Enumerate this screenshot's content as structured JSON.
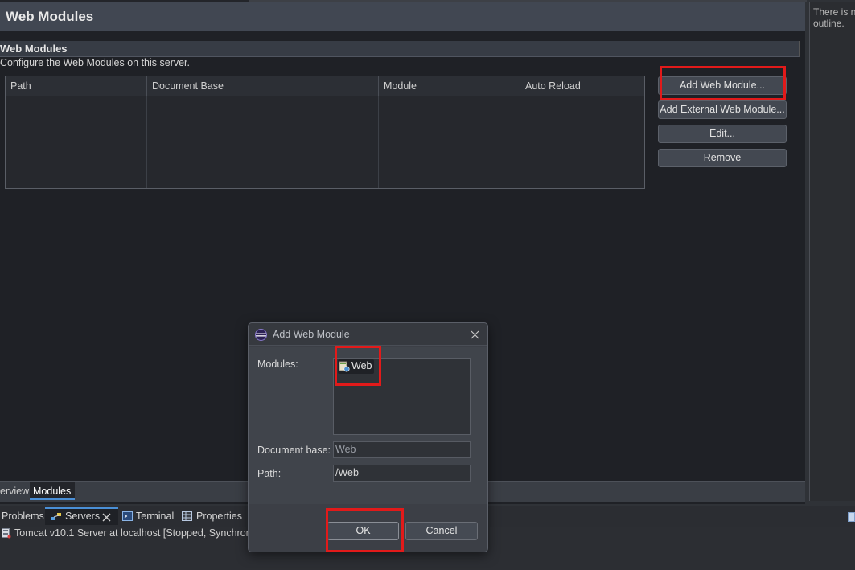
{
  "editor": {
    "header_title": "Web Modules",
    "section_title": "Web Modules",
    "section_description": "Configure the Web Modules on this server.",
    "table_columns": [
      "Path",
      "Document Base",
      "Module",
      "Auto Reload"
    ],
    "buttons": {
      "add_web_module": "Add Web Module...",
      "add_external": "Add External Web Module...",
      "edit": "Edit...",
      "remove": "Remove"
    },
    "bottom_tabs": [
      "erview",
      "Modules"
    ]
  },
  "outline": {
    "text_line1": "There is n",
    "text_line2": "outline."
  },
  "views": {
    "tabs": [
      "Problems",
      "Servers",
      "Terminal",
      "Properties"
    ],
    "console_line": "Tomcat v10.1 Server at localhost  [Stopped, Synchron"
  },
  "dialog": {
    "title": "Add Web Module",
    "modules_label": "Modules:",
    "module_item": "Web",
    "document_base_label": "Document base:",
    "document_base_value": "Web",
    "path_label": "Path:",
    "path_value": "/Web",
    "ok": "OK",
    "cancel": "Cancel"
  },
  "colors": {
    "highlight": "#e21a1a",
    "accent_tab": "#4a8fd6"
  }
}
